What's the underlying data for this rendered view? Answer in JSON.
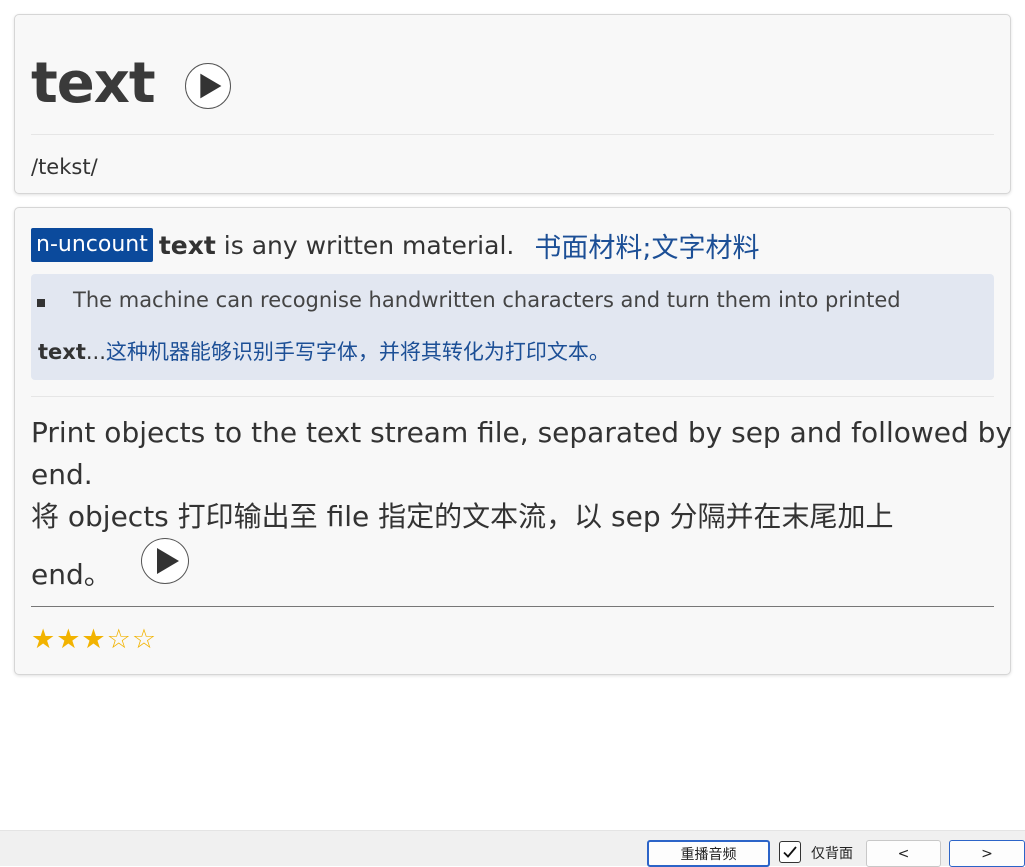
{
  "header": {
    "word": "text",
    "phonetic": "/tekst/"
  },
  "definition": {
    "pos": "n-uncount",
    "headword": "text",
    "text_en": " is any written material.",
    "text_zh": "书面材料;文字材料",
    "example": {
      "line1": "The machine can recognise handwritten characters and turn them into printed",
      "keyword": "text",
      "ellipsis": "...",
      "zh": " 这种机器能够识别手写字体，并将其转化为打印文本。"
    }
  },
  "translation": {
    "line1": "Print objects to the text stream file, separated by sep and followed by",
    "line2": "end.",
    "line3": "将 objects 打印输出至 file 指定的文本流，以 sep 分隔并在末尾加上",
    "line4": "end。"
  },
  "rating": {
    "filled_stars": "★★★",
    "empty_stars": "☆☆",
    "value": 3,
    "max": 5,
    "color": "#f2b300"
  },
  "bottom_bar": {
    "replay_label": "重播音频",
    "back_only_label": "仅背面",
    "back_only_checked": true,
    "prev_label": "<",
    "next_label": ">"
  },
  "colors": {
    "pos_badge": "#0b4a9c",
    "chinese_text": "#1c4f96",
    "example_bg": "#e2e7f1",
    "focus_border": "#2c64c8"
  },
  "icons": {
    "play": "play-icon",
    "check": "check-icon",
    "bullet": "square-bullet-icon"
  }
}
